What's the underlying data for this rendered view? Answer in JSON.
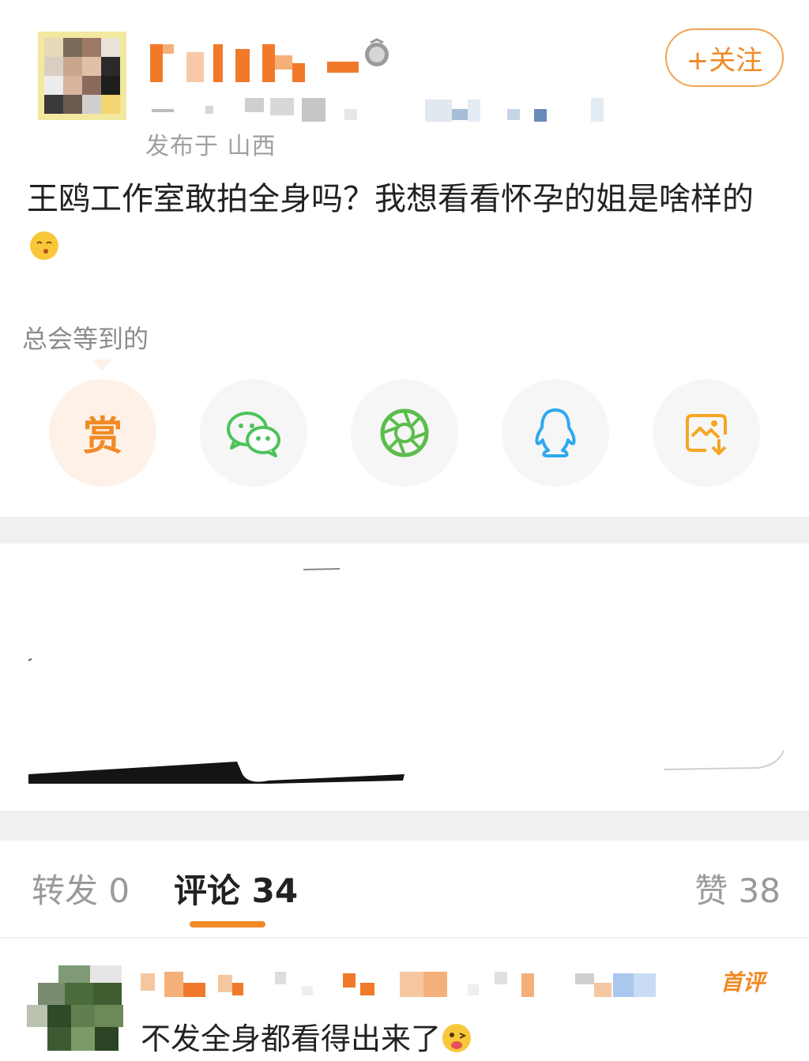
{
  "author": {
    "location_text": "发布于 山西",
    "follow_label": "+关注"
  },
  "post": {
    "text": "王鸥工作室敢拍全身吗？我想看看怀孕的姐是啥样的",
    "emoji": "kissing-face-emoji",
    "signature": "总会等到的"
  },
  "share": {
    "reward_label": "赏",
    "icons": [
      "reward-icon",
      "wechat-icon",
      "moments-icon",
      "qq-icon",
      "save-image-icon"
    ]
  },
  "tabs": {
    "repost": "转发 0",
    "comment": "评论 34",
    "like": "赞 38"
  },
  "comment": {
    "badge": "首评",
    "text": "不发全身都看得出来了",
    "emoji": "tongue-face-emoji"
  },
  "colors": {
    "accent": "#f08a24",
    "wechat": "#4cc35a",
    "moments": "#5bbd4c",
    "qq": "#2ea8f0",
    "muted": "#a0a0a0"
  }
}
